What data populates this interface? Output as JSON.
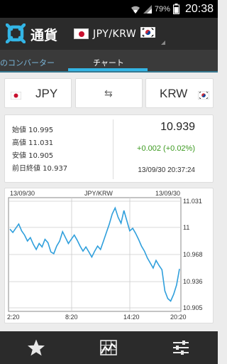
{
  "status_bar": {
    "battery": "79%",
    "time": "20:38"
  },
  "app": {
    "title": "通貨"
  },
  "pair_spinner": {
    "label": "JPY/KRW"
  },
  "tabs": {
    "converter": "のコンバーター",
    "chart": "チャート"
  },
  "currency_row": {
    "from": "JPY",
    "swap": "⇆",
    "to": "KRW"
  },
  "stats": {
    "open": "始値 10.995",
    "high": "高値 11.031",
    "low": "安値 10.905",
    "prev_close": "前日終値 10.937",
    "rate": "10.939",
    "change": "+0.002 (+0.02%)",
    "timestamp": "13/09/30 20:37:24"
  },
  "chart_data": {
    "type": "line",
    "date_left": "13/09/30",
    "pair_label": "JPY/KRW",
    "date_right": "13/09/30",
    "x_ticks": [
      "2:20",
      "8:20",
      "14:20",
      "20:20"
    ],
    "y_ticks": [
      "11.031",
      "11",
      "10.968",
      "10.936",
      "10.905"
    ],
    "ylim": [
      10.905,
      11.031
    ],
    "grid": true,
    "series": [
      {
        "color": "#2f9fdc",
        "values": [
          10.998,
          10.994,
          10.999,
          11.004,
          10.996,
          10.991,
          10.984,
          10.988,
          10.98,
          10.974,
          10.981,
          10.977,
          10.986,
          10.982,
          10.971,
          10.969,
          10.978,
          10.984,
          10.995,
          10.988,
          10.981,
          10.986,
          10.991,
          10.985,
          10.978,
          10.972,
          10.977,
          10.971,
          10.965,
          10.972,
          10.978,
          10.974,
          10.984,
          10.994,
          11.004,
          11.016,
          11.023,
          11.012,
          11.005,
          11.02,
          11.008,
          10.996,
          10.999,
          10.993,
          10.986,
          10.978,
          10.972,
          10.964,
          10.958,
          10.952,
          10.961,
          10.955,
          10.95,
          10.925,
          10.916,
          10.913,
          10.921,
          10.932,
          10.951
        ]
      }
    ]
  },
  "bottom_bar": {
    "favorites_icon": "star-icon",
    "chart_icon": "chart-grid-icon",
    "settings_icon": "sliders-icon"
  }
}
